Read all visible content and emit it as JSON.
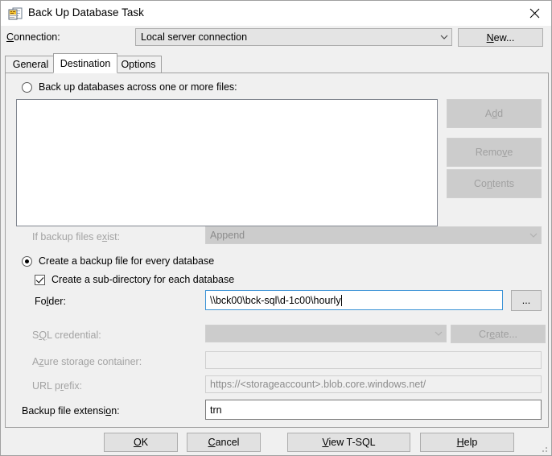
{
  "window": {
    "title": "Back Up Database Task",
    "icon": "backup-task-icon",
    "close_label": "✕"
  },
  "connection": {
    "label": "Connection:",
    "value": "Local server connection",
    "new_button": "New..."
  },
  "tabs": [
    {
      "label": "General",
      "active": false
    },
    {
      "label": "Destination",
      "active": true
    },
    {
      "label": "Options",
      "active": false
    }
  ],
  "destination": {
    "across_files": {
      "label": "Back up databases across one or more files:",
      "selected": false
    },
    "file_list": {
      "items": []
    },
    "side_buttons": [
      {
        "label": "Add",
        "enabled": false
      },
      {
        "label": "Remove",
        "enabled": false
      },
      {
        "label": "Contents",
        "enabled": false
      }
    ],
    "if_exists": {
      "label": "If backup files exist:",
      "value": "Append",
      "enabled": false
    },
    "per_database": {
      "label": "Create a backup file for every database",
      "selected": true
    },
    "sub_directory": {
      "label": "Create a sub-directory for each database",
      "checked": true
    },
    "folder": {
      "label": "Folder:",
      "value": "\\\\bck00\\bck-sql\\d-1c00\\hourly",
      "focused": true,
      "browse_label": "..."
    },
    "sql_credential": {
      "label": "SQL credential:",
      "value": "",
      "enabled": false,
      "create_label": "Create...",
      "create_enabled": false
    },
    "azure_container": {
      "label": "Azure storage container:",
      "value": "",
      "enabled": false
    },
    "url_prefix": {
      "label": "URL prefix:",
      "value": "https://<storageaccount>.blob.core.windows.net/",
      "enabled": false
    },
    "file_extension": {
      "label": "Backup file extension:",
      "value": "trn",
      "enabled": true
    }
  },
  "footer": [
    {
      "label": "OK"
    },
    {
      "label": "Cancel"
    },
    {
      "label": "View T-SQL"
    },
    {
      "label": "Help"
    }
  ],
  "colors": {
    "dialog_bg": "#f0f0f0",
    "focus_border": "#3c93d6",
    "disabled_text": "#a3a3a3"
  }
}
